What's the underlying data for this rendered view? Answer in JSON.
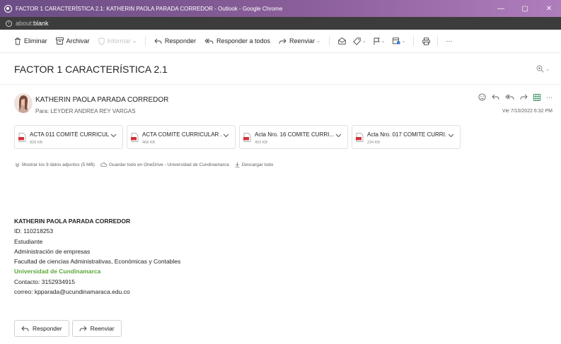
{
  "window": {
    "title": "FACTOR 1 CARACTERÍSTICA 2.1: KATHERIN PAOLA PARADA CORREDOR - Outlook - Google Chrome",
    "minimize": "—",
    "restore": "▢",
    "close": "✕"
  },
  "address": {
    "scheme": "about:",
    "host": "blank"
  },
  "toolbar": {
    "delete": "Eliminar",
    "archive": "Archivar",
    "report": "Informar",
    "reply": "Responder",
    "reply_all": "Responder a todos",
    "forward": "Reenviar",
    "more": "···"
  },
  "message": {
    "subject": "FACTOR 1 CARACTERÍSTICA 2.1",
    "sender": "KATHERIN PAOLA PARADA CORREDOR",
    "to_prefix": "Para:",
    "to": "LEYDER ANDREA REY VARGAS",
    "date": "Vie 7/10/2022 6:32 PM"
  },
  "attachments": [
    {
      "name": "ACTA 011 COMITÉ CURRICUL...",
      "size": "828 KB"
    },
    {
      "name": "ACTA COMITE CURRICULAR ...",
      "size": "468 KB"
    },
    {
      "name": "Acta Nro. 16 COMITE CURRI...",
      "size": "403 KB"
    },
    {
      "name": "Acta Nro. 017 COMITE CURRI...",
      "size": "234 KB"
    }
  ],
  "attachment_links": {
    "show_all": "Mostrar los 9 datos adjuntos (5 MB)",
    "save_onedrive": "Guardar todo en OneDrive - Universidad de Cundinamarca",
    "download_all": "Descargar todo"
  },
  "signature": {
    "name": "KATHERIN PAOLA PARADA CORREDOR",
    "id": "ID: 110218253",
    "role": "Estudiante",
    "program": "Administración de empresas",
    "faculty": "Facultad de ciencias Administrativas, Económicas y Contables",
    "university": "Universidad de Cundinamarca",
    "contact": "Contacto: 3152934915",
    "email": "correo: kpparada@ucundinamaraca.edu.co"
  },
  "footer": {
    "reply": "Responder",
    "forward": "Reenviar"
  },
  "colors": {
    "titlebar": "#8b5f9a",
    "university_green": "#5aa839",
    "pdf_red": "#d13438"
  }
}
